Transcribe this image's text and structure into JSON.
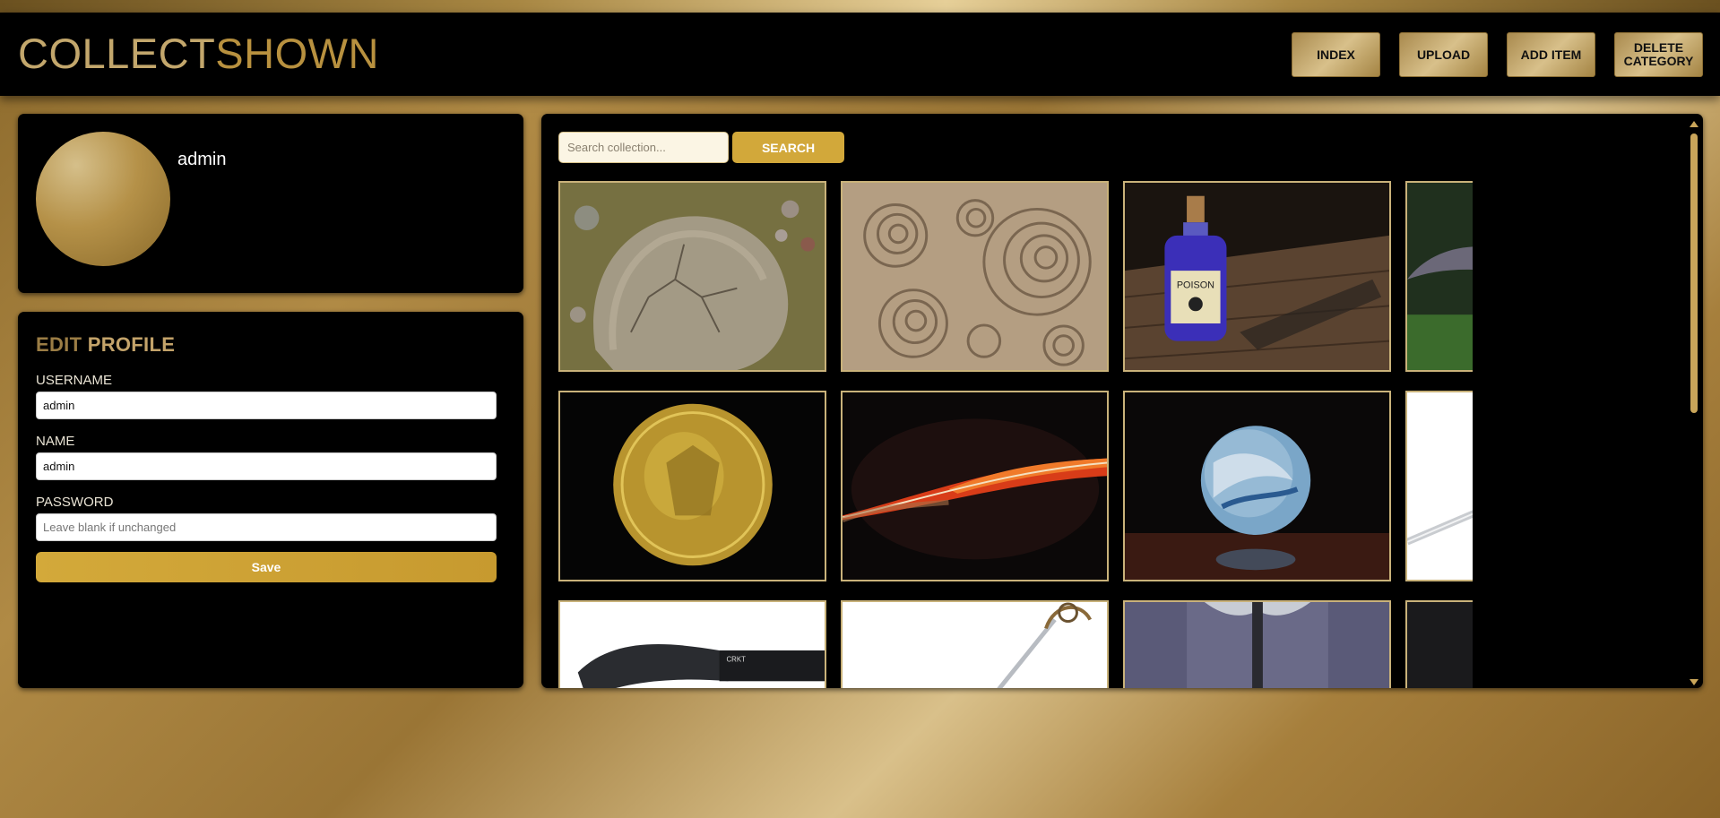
{
  "app": {
    "logo_part1": "COLLECT",
    "logo_part2": "SHOWN"
  },
  "nav": {
    "index": "INDEX",
    "upload": "UPLOAD",
    "add_item": "ADD ITEM",
    "delete_category_line1": "DELETE",
    "delete_category_line2": "CATEGORY"
  },
  "profile": {
    "username": "admin"
  },
  "edit_profile": {
    "title_part1": "EDIT",
    "title_part2": "PROFILE",
    "username_label": "USERNAME",
    "username_value": "admin",
    "name_label": "NAME",
    "name_value": "admin",
    "password_label": "PASSWORD",
    "password_placeholder": "Leave blank if unchanged",
    "save_label": "Save"
  },
  "search": {
    "placeholder": "Search collection...",
    "button_label": "SEARCH"
  },
  "gallery": {
    "items": [
      {
        "subject": "cracked-stone"
      },
      {
        "subject": "ammonite-fossils"
      },
      {
        "subject": "poison-bottle",
        "label": "POISON"
      },
      {
        "subject": "bat-flower"
      },
      {
        "subject": "gold-coin"
      },
      {
        "subject": "red-feather"
      },
      {
        "subject": "glass-marble"
      },
      {
        "subject": "longsword"
      },
      {
        "subject": "kukri-knife",
        "label": "CRKT"
      },
      {
        "subject": "rapier"
      },
      {
        "subject": "battle-axe"
      },
      {
        "subject": "fantasy-dagger"
      }
    ]
  },
  "colors": {
    "gold_accent": "#d2a83a",
    "panel_bg": "#000000",
    "tile_border": "#c9b27a"
  }
}
